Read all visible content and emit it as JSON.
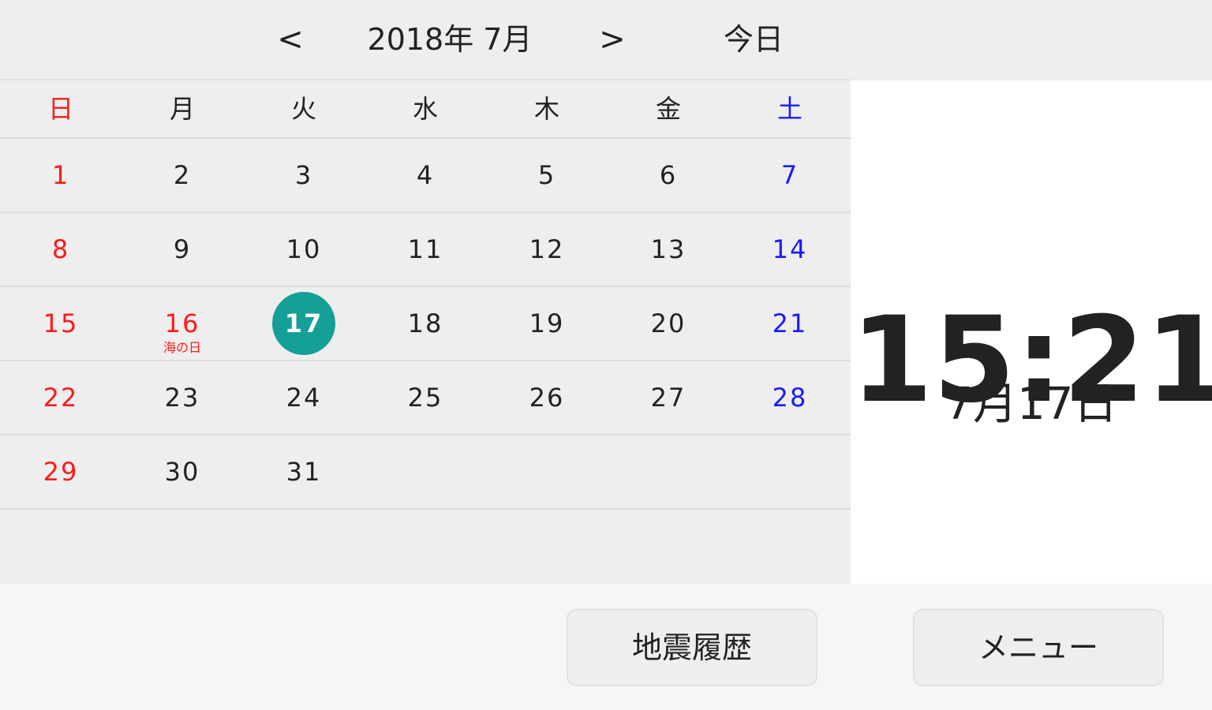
{
  "header": {
    "prev_label": "<",
    "title": "2018年 7月",
    "next_label": ">",
    "today_label": "今日"
  },
  "calendar": {
    "weekdays": [
      "日",
      "月",
      "火",
      "水",
      "木",
      "金",
      "土"
    ],
    "weeks": [
      [
        "1",
        "2",
        "3",
        "4",
        "5",
        "6",
        "7"
      ],
      [
        "8",
        "9",
        "10",
        "11",
        "12",
        "13",
        "14"
      ],
      [
        "15",
        "16",
        "17",
        "18",
        "19",
        "20",
        "21"
      ],
      [
        "22",
        "23",
        "24",
        "25",
        "26",
        "27",
        "28"
      ],
      [
        "29",
        "30",
        "31",
        "",
        "",
        "",
        ""
      ],
      [
        "",
        "",
        "",
        "",
        "",
        "",
        ""
      ]
    ],
    "holiday": {
      "day": "16",
      "name": "海の日"
    },
    "selected_day": "17",
    "colors": {
      "sunday": "#ff1a1a",
      "saturday": "#1a1aff",
      "selected": "#14a096"
    }
  },
  "clock": {
    "time": "15:21",
    "date": "7月17日"
  },
  "footer": {
    "quake_button": "地震履歴",
    "menu_button": "メニュー"
  }
}
